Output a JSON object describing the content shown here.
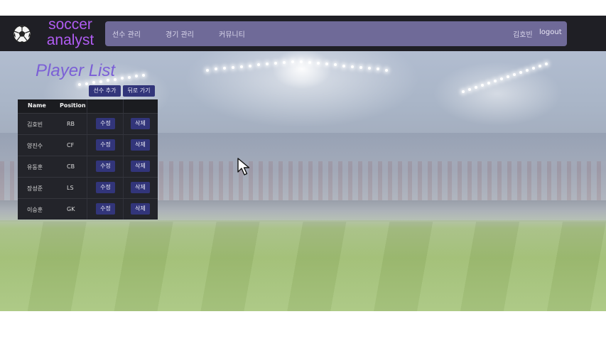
{
  "brand": {
    "line1": "soccer",
    "line2": "analyst"
  },
  "nav": {
    "items": [
      "선수 관리",
      "경기 관리",
      "커뮤니티"
    ],
    "user": "김호빈",
    "logout": "logout"
  },
  "page": {
    "title": "Player List",
    "add_button": "선수 추가",
    "back_button": "뒤로 가기"
  },
  "table": {
    "headers": [
      "Name",
      "Position"
    ],
    "edit_label": "수정",
    "delete_label": "삭제",
    "rows": [
      {
        "name": "김호빈",
        "position": "RB"
      },
      {
        "name": "양진수",
        "position": "CF"
      },
      {
        "name": "유동훈",
        "position": "CB"
      },
      {
        "name": "장성준",
        "position": "LS"
      },
      {
        "name": "이승훈",
        "position": "GK"
      }
    ]
  },
  "colors": {
    "navbar": "#1f1f25",
    "menu_bar": "#6f6a98",
    "brand": "#b05cf2",
    "button": "#32357a",
    "title": "#7b5fd6"
  },
  "icons": {
    "logo": "soccer-ball-icon",
    "pointer": "mouse-cursor-icon"
  }
}
